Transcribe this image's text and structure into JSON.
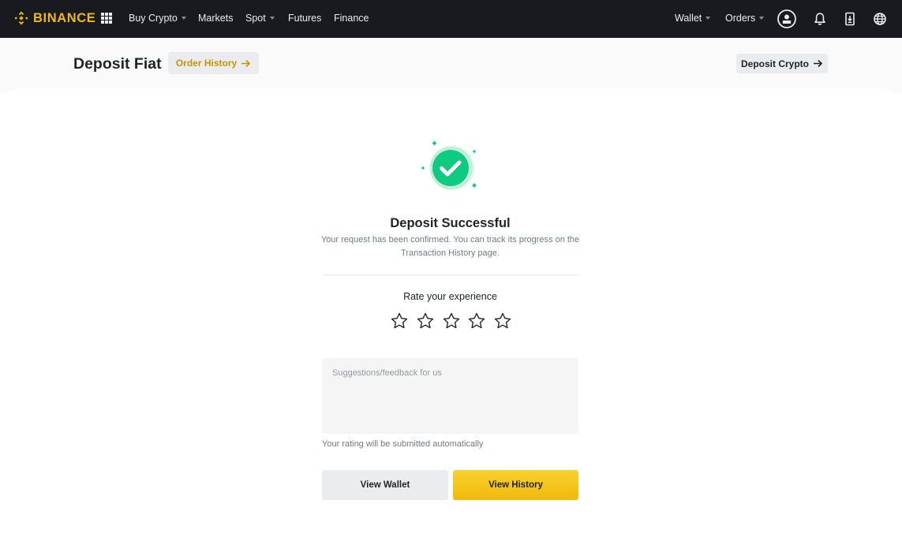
{
  "brand": {
    "name": "BINANCE",
    "color": "#f0b90b"
  },
  "topnav": {
    "apps_icon": "grid-icon",
    "items": [
      {
        "label": "Buy Crypto",
        "dropdown": true
      },
      {
        "label": "Markets",
        "dropdown": false
      },
      {
        "label": "Spot",
        "dropdown": true
      },
      {
        "label": "Futures",
        "dropdown": false
      },
      {
        "label": "Finance",
        "dropdown": false
      }
    ],
    "right_items": [
      {
        "label": "Wallet",
        "dropdown": true
      },
      {
        "label": "Orders",
        "dropdown": true
      }
    ],
    "icons": [
      "user-profile-icon",
      "bell-icon",
      "download-app-icon",
      "globe-icon"
    ]
  },
  "header": {
    "title": "Deposit Fiat",
    "order_history_label": "Order History",
    "deposit_crypto_label": "Deposit Crypto"
  },
  "result": {
    "status_icon": "success-check-icon",
    "title": "Deposit Successful",
    "description": "Your request has been confirmed. You can track its progress on the Transaction History page."
  },
  "rating": {
    "label": "Rate your experience",
    "max_stars": 5,
    "selected": 0,
    "feedback_placeholder": "Suggestions/feedback for us",
    "feedback_value": "",
    "note": "Your rating will be submitted automatically"
  },
  "actions": {
    "view_wallet_label": "View Wallet",
    "view_history_label": "View History"
  },
  "colors": {
    "nav_bg": "#181a20",
    "accent": "#f0b90b",
    "success": "#0ecb81",
    "button_gray": "#eaecef"
  }
}
